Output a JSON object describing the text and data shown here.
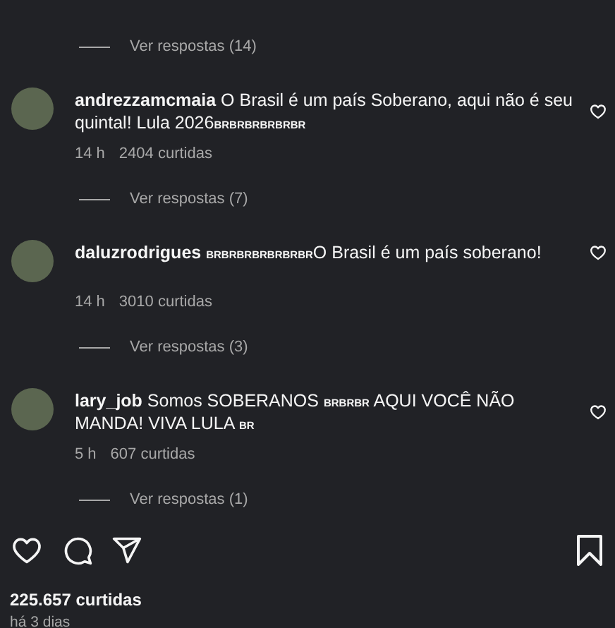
{
  "top_replies": {
    "label": "Ver respostas (14)"
  },
  "comments": [
    {
      "username": "andrezzamcmaia",
      "body": [
        {
          "kind": "text",
          "text": "O Brasil é um país Soberano, aqui não é seu quintal! Lula 2026"
        },
        {
          "kind": "flag",
          "text": "BRBRBRBRBRBR"
        }
      ],
      "time": "14 h",
      "likes": "2404 curtidas",
      "replies": "Ver respostas (7)"
    },
    {
      "username": "daluzrodrigues",
      "body": [
        {
          "kind": "flag",
          "text": "BRBRBRBRBRBRBR"
        },
        {
          "kind": "text",
          "text": "O Brasil é um país soberano!"
        }
      ],
      "time": "14 h",
      "likes": "3010 curtidas",
      "replies": "Ver respostas (3)"
    },
    {
      "username": "lary_job",
      "body": [
        {
          "kind": "text",
          "text": "Somos SOBERANOS "
        },
        {
          "kind": "flag",
          "text": "BRBRBR"
        },
        {
          "kind": "text",
          "text": " AQUI VOCÊ NÃO MANDA! VIVA LULA "
        },
        {
          "kind": "flag",
          "text": "BR"
        }
      ],
      "time": "5 h",
      "likes": "607 curtidas",
      "replies": "Ver respostas (1)"
    }
  ],
  "post": {
    "likes": "225.657 curtidas",
    "date": "há 3 dias"
  }
}
